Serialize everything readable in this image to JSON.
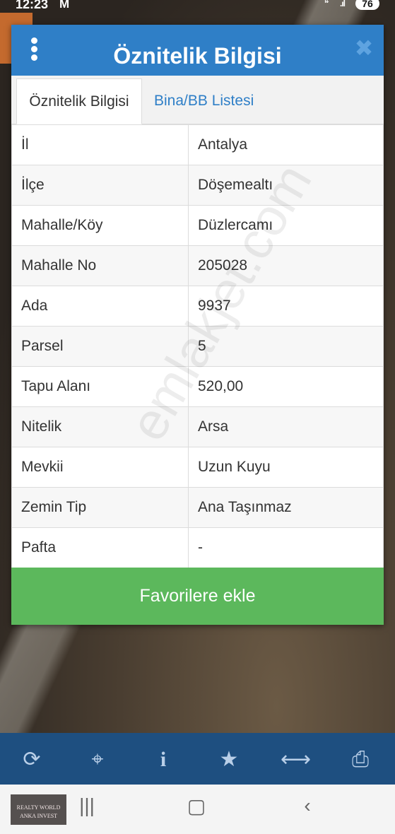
{
  "status_bar": {
    "time": "12:23",
    "mail_icon": "gmail-icon",
    "battery": "76"
  },
  "dialog": {
    "title": "Öznitelik Bilgisi",
    "tabs": [
      {
        "label": "Öznitelik Bilgisi",
        "active": true
      },
      {
        "label": "Bina/BB Listesi",
        "active": false
      }
    ],
    "rows": [
      {
        "key": "İl",
        "value": "Antalya"
      },
      {
        "key": "İlçe",
        "value": "Döşemealtı"
      },
      {
        "key": "Mahalle/Köy",
        "value": "Düzlercamı"
      },
      {
        "key": "Mahalle No",
        "value": "205028"
      },
      {
        "key": "Ada",
        "value": "9937"
      },
      {
        "key": "Parsel",
        "value": "5"
      },
      {
        "key": "Tapu Alanı",
        "value": "520,00"
      },
      {
        "key": "Nitelik",
        "value": "Arsa"
      },
      {
        "key": "Mevkii",
        "value": "Uzun Kuyu"
      },
      {
        "key": "Zemin Tip",
        "value": "Ana Taşınmaz"
      },
      {
        "key": "Pafta",
        "value": "-"
      }
    ],
    "favorite_button": "Favorilere ekle",
    "watermark": "emlakjet.com"
  },
  "toolbar": {
    "icons": [
      "refresh-icon",
      "locate-icon",
      "info-icon",
      "star-icon",
      "measure-icon",
      "print-icon"
    ]
  },
  "nav_bar": {
    "logo_text": "REALTY WORLD ANKA INVEST"
  },
  "colors": {
    "header_blue": "#2f7fc7",
    "toolbar_blue": "#1e4f80",
    "button_green": "#5cb85c"
  }
}
